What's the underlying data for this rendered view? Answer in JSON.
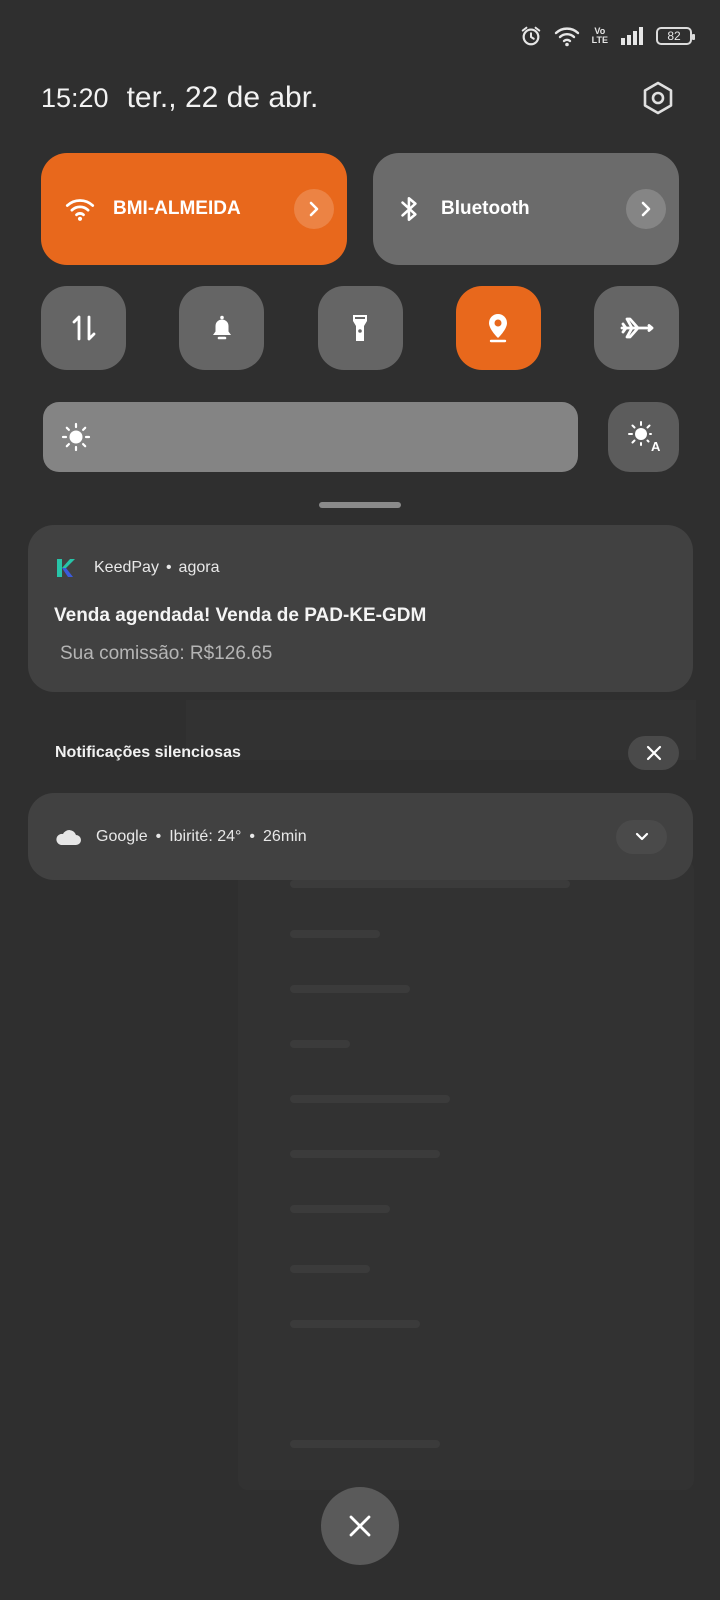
{
  "status_bar": {
    "icons": [
      "alarm-icon",
      "wifi-icon",
      "volte-icon",
      "signal-icon"
    ],
    "volte_top": "Vo",
    "volte_bottom": "LTE",
    "battery": "82"
  },
  "header": {
    "time": "15:20",
    "date": "ter., 22 de abr.",
    "settings_icon": "gear-icon"
  },
  "quick_tiles": {
    "wifi": {
      "label": "BMI-ALMEIDA",
      "state": "on",
      "icon": "wifi-icon"
    },
    "bluetooth": {
      "label": "Bluetooth",
      "state": "off",
      "icon": "bluetooth-icon"
    },
    "toggles": [
      {
        "name": "mobile-data",
        "icon": "data-arrows-icon",
        "state": "off"
      },
      {
        "name": "sound",
        "icon": "bell-icon",
        "state": "off"
      },
      {
        "name": "flashlight",
        "icon": "flashlight-icon",
        "state": "off"
      },
      {
        "name": "location",
        "icon": "location-pin-icon",
        "state": "on"
      },
      {
        "name": "airplane-mode",
        "icon": "airplane-icon",
        "state": "off"
      }
    ]
  },
  "brightness": {
    "icon": "sun-icon",
    "auto_icon": "auto-brightness-icon",
    "level": 1.0
  },
  "notification": {
    "app": "KeedPay",
    "separator": "•",
    "time": "agora",
    "title": "Venda agendada! Venda de PAD-KE-GDM",
    "text": "Sua comissão: R$126.65"
  },
  "silent": {
    "label": "Notificações silenciosas"
  },
  "google_notification": {
    "app": "Google",
    "separator": "•",
    "weather": "Ibirité: 24°",
    "time": "26min"
  },
  "colors": {
    "accent": "#e8681c",
    "background": "#2f2f2f",
    "tile_off": "#656565",
    "card": "#414141"
  }
}
